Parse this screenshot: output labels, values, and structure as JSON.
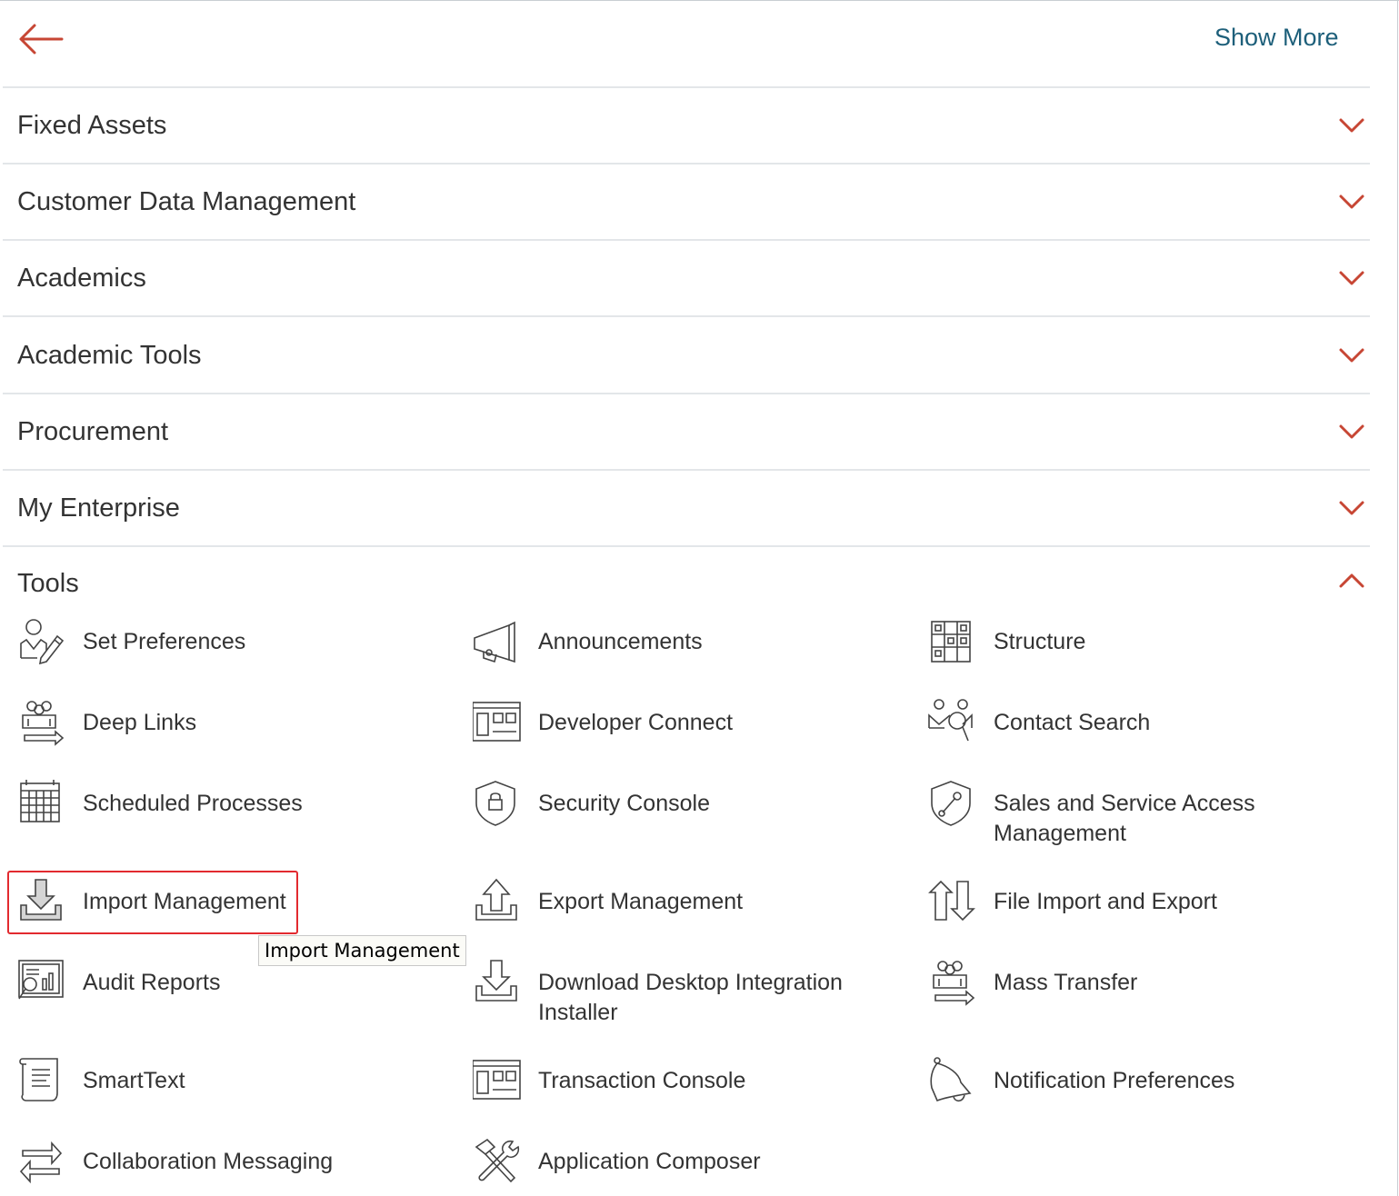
{
  "header": {
    "show_more_label": "Show More"
  },
  "sections": [
    {
      "title": "Fixed Assets"
    },
    {
      "title": "Customer Data Management"
    },
    {
      "title": "Academics"
    },
    {
      "title": "Academic Tools"
    },
    {
      "title": "Procurement"
    },
    {
      "title": "My Enterprise"
    }
  ],
  "tools": {
    "title": "Tools",
    "items": [
      {
        "label": "Set Preferences",
        "icon": "user-pencil-icon"
      },
      {
        "label": "Announcements",
        "icon": "megaphone-icon"
      },
      {
        "label": "Structure",
        "icon": "grid-structure-icon"
      },
      {
        "label": "Deep Links",
        "icon": "group-arrow-icon"
      },
      {
        "label": "Developer Connect",
        "icon": "window-panel-icon"
      },
      {
        "label": "Contact Search",
        "icon": "people-search-icon"
      },
      {
        "label": "Scheduled Processes",
        "icon": "calendar-icon"
      },
      {
        "label": "Security Console",
        "icon": "shield-lock-icon"
      },
      {
        "label": "Sales and Service Access Management",
        "icon": "shield-wrench-icon"
      },
      {
        "label": "Import Management",
        "icon": "download-tray-icon"
      },
      {
        "label": "Export Management",
        "icon": "upload-tray-icon"
      },
      {
        "label": "File Import and Export",
        "icon": "up-down-arrows-icon"
      },
      {
        "label": "Audit Reports",
        "icon": "report-magnifier-icon"
      },
      {
        "label": "Download Desktop Integration Installer",
        "icon": "download-tray-icon"
      },
      {
        "label": "Mass Transfer",
        "icon": "group-arrow-icon"
      },
      {
        "label": "SmartText",
        "icon": "scroll-document-icon"
      },
      {
        "label": "Transaction Console",
        "icon": "window-panel-icon"
      },
      {
        "label": "Notification Preferences",
        "icon": "bell-icon"
      },
      {
        "label": "Collaboration Messaging",
        "icon": "exchange-arrows-icon"
      },
      {
        "label": "Application Composer",
        "icon": "tools-crossed-icon"
      }
    ]
  },
  "tooltip": {
    "text": "Import Management"
  },
  "colors": {
    "accent": "#c74634",
    "link": "#1d5f7a",
    "highlight": "#e22a2f"
  }
}
